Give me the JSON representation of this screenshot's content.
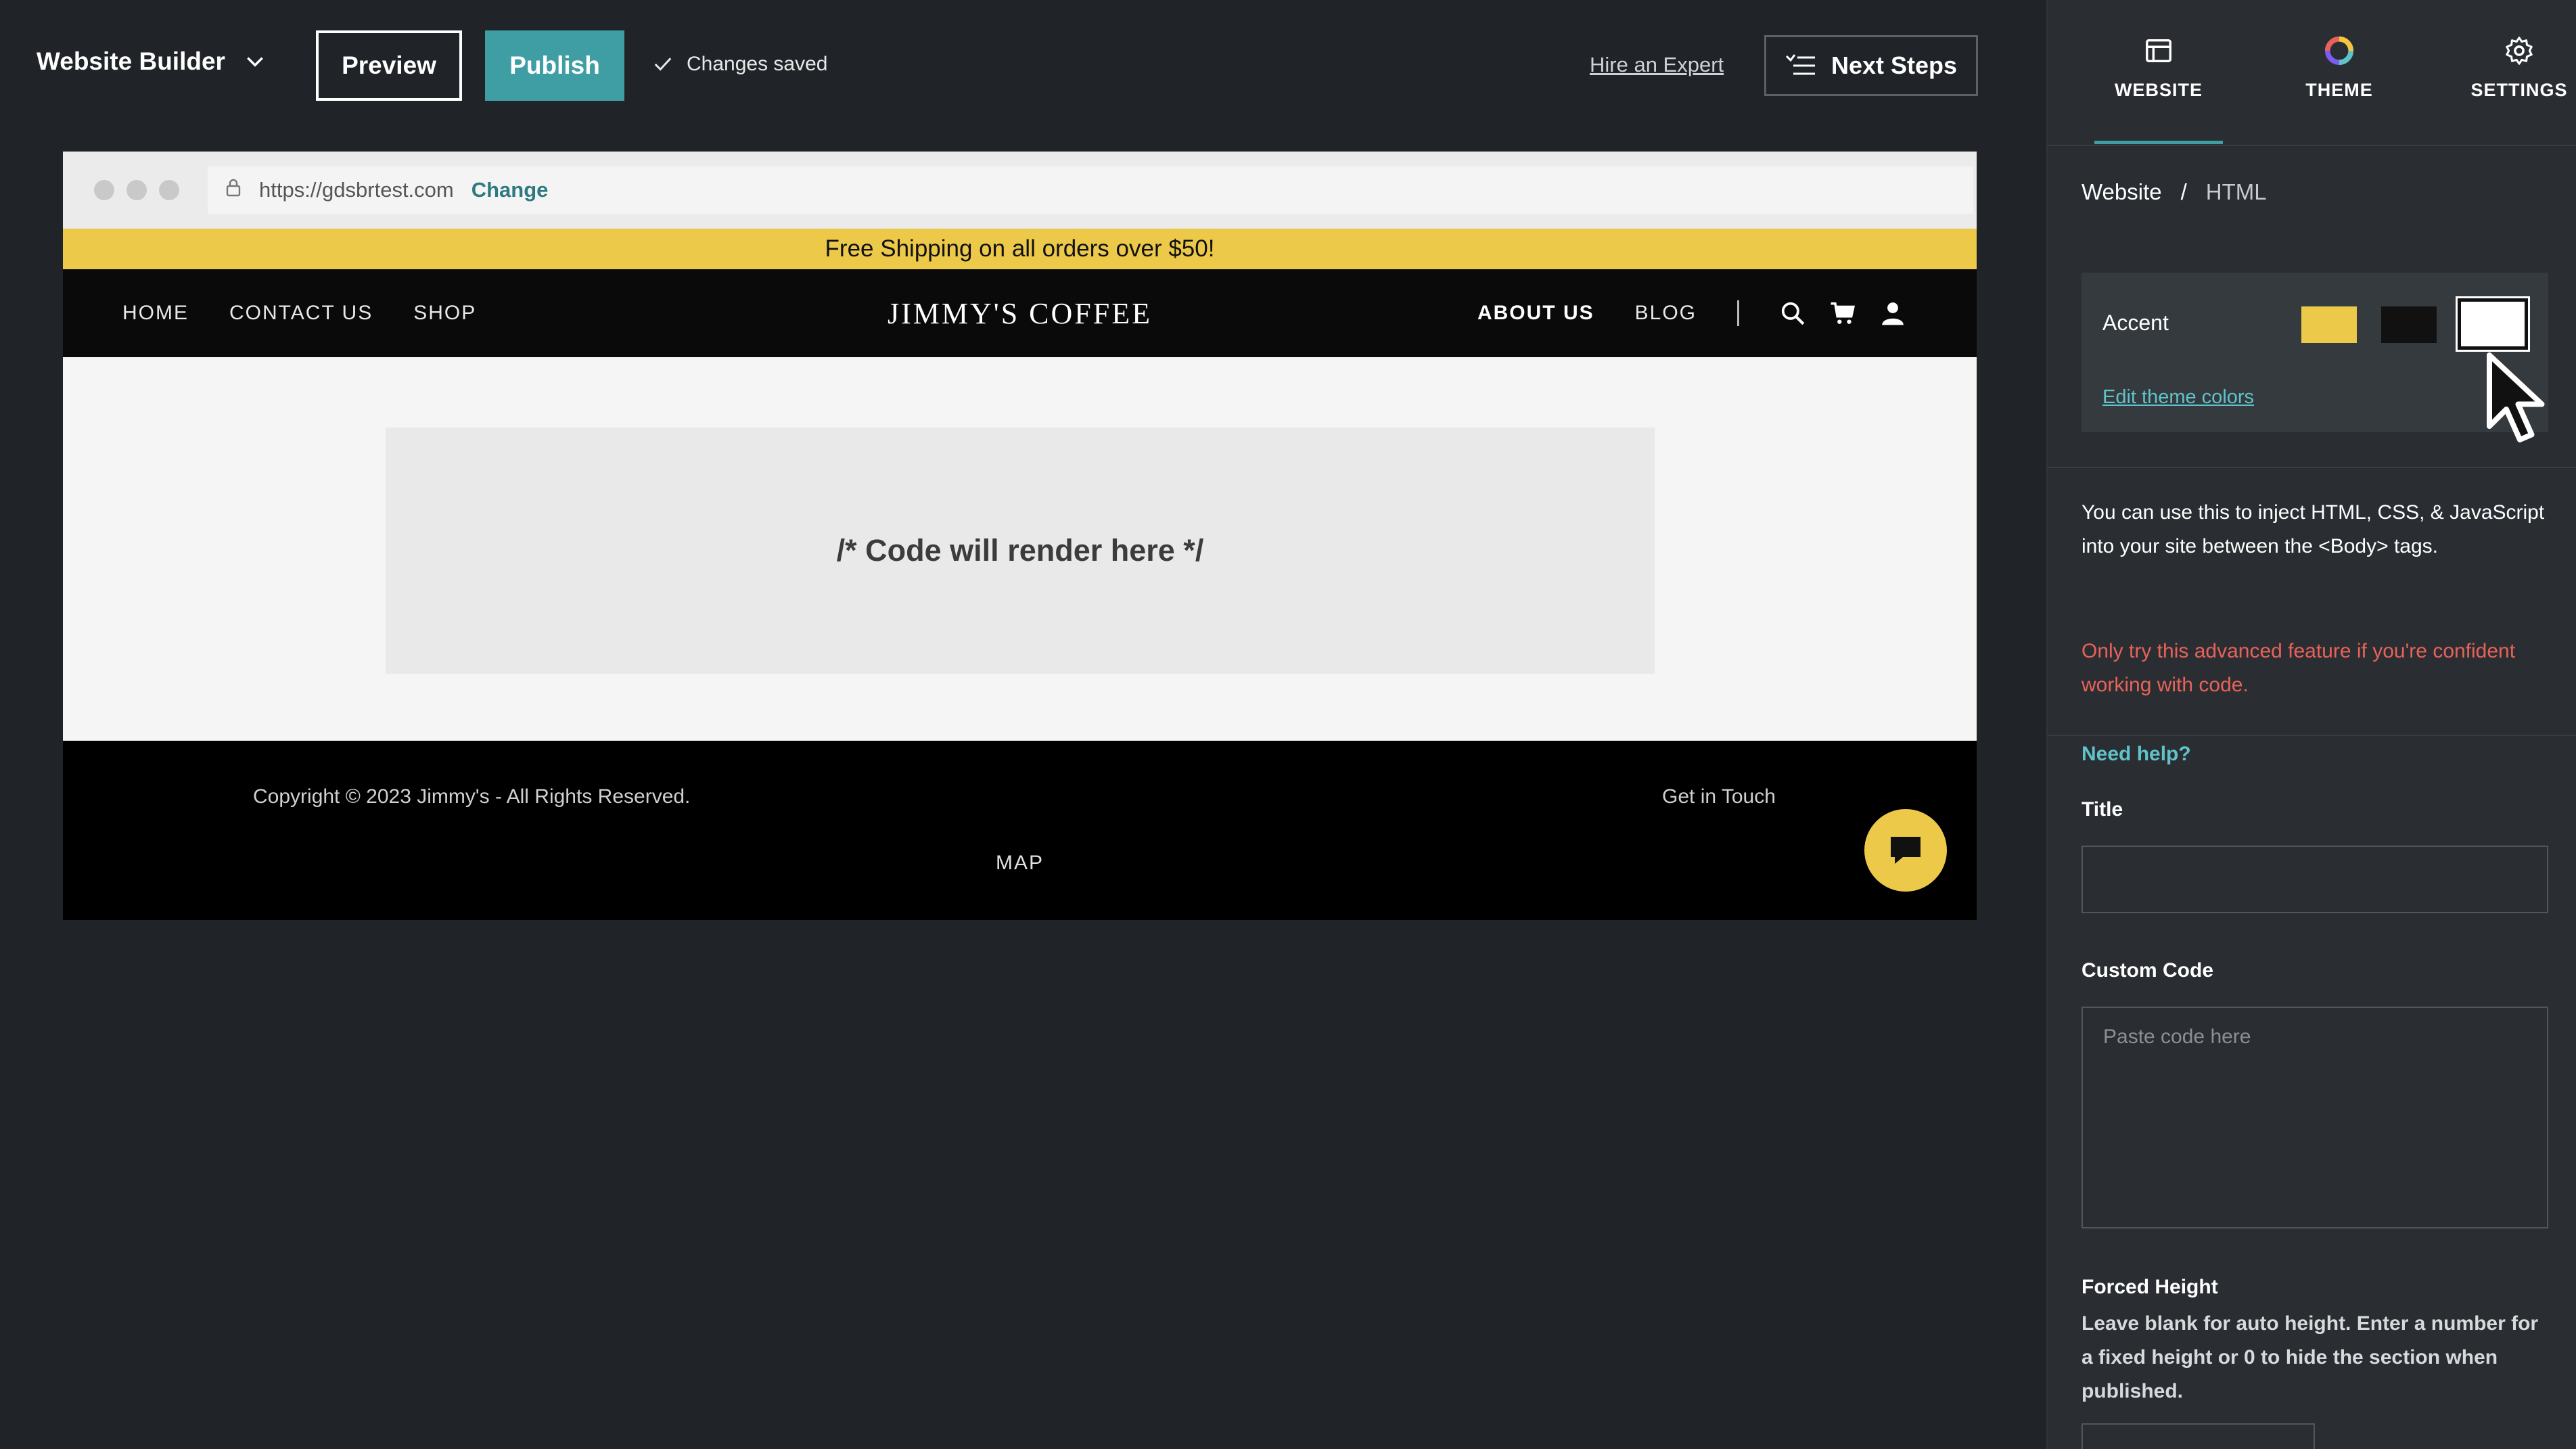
{
  "topbar": {
    "brand": "Website Builder",
    "preview_label": "Preview",
    "publish_label": "Publish",
    "status": "Changes saved",
    "hire_label": "Hire an Expert",
    "next_steps_label": "Next Steps"
  },
  "browser": {
    "url": "https://gdsbrtest.com",
    "change_label": "Change"
  },
  "site": {
    "promo": "Free Shipping on all orders over $50!",
    "nav_left": [
      "HOME",
      "CONTACT US",
      "SHOP"
    ],
    "logo": "JIMMY'S COFFEE",
    "nav_right_active": "ABOUT US",
    "nav_right_blog": "BLOG",
    "placeholder": "/* Code will render here */",
    "copyright": "Copyright © 2023 Jimmy's - All Rights Reserved.",
    "get_in_touch": "Get in Touch",
    "map_label": "MAP"
  },
  "panel": {
    "tabs": [
      {
        "label": "WEBSITE",
        "icon": "browser-window-icon"
      },
      {
        "label": "THEME",
        "icon": "color-wheel-icon"
      },
      {
        "label": "SETTINGS",
        "icon": "gear-icon"
      }
    ],
    "breadcrumb": {
      "root": "Website",
      "separator": "/",
      "current": "HTML"
    },
    "accent": {
      "label": "Accent",
      "swatches": [
        "#edc94a",
        "#111111",
        "#ffffff"
      ],
      "edit_link": "Edit theme colors"
    },
    "description": "You can use this to inject HTML, CSS, & JavaScript into your site between the <Body> tags.",
    "warning": "Only try this advanced feature if you're confident working with code.",
    "need_help": "Need help?",
    "title_label": "Title",
    "title_value": "",
    "custom_code_label": "Custom Code",
    "custom_code_placeholder": "Paste code here",
    "forced_height_label": "Forced Height",
    "forced_height_desc": "Leave blank for auto height. Enter a number for a fixed height or 0 to hide the section when published."
  },
  "colors": {
    "accent_teal": "#3f9ea3",
    "promo_yellow": "#edc94a",
    "warning_red": "#e8625a",
    "link_teal": "#5fc3c9"
  }
}
